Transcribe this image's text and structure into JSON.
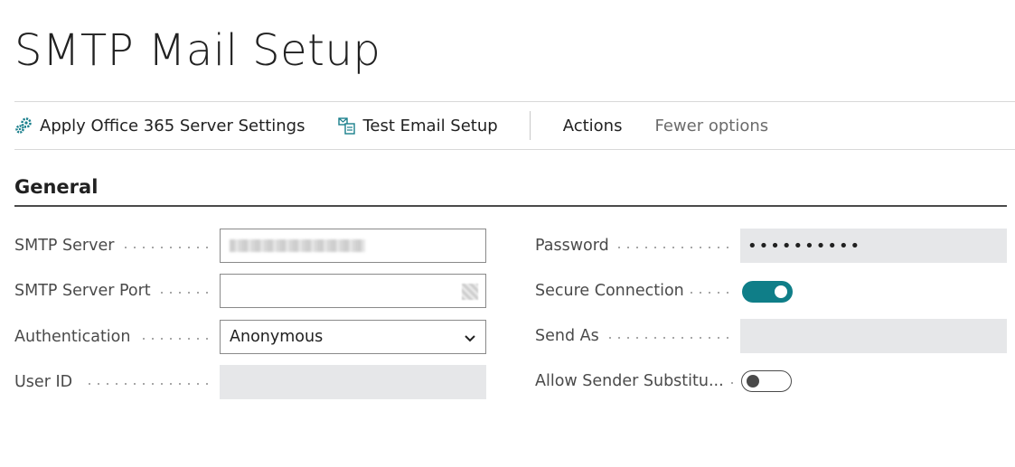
{
  "page": {
    "title": "SMTP Mail Setup"
  },
  "actionbar": {
    "apply_o365": "Apply Office 365 Server Settings",
    "test_email": "Test Email Setup",
    "actions": "Actions",
    "fewer_options": "Fewer options"
  },
  "section": {
    "title": "General"
  },
  "fields": {
    "smtp_server": {
      "label": "SMTP Server",
      "value": ""
    },
    "smtp_server_port": {
      "label": "SMTP Server Port",
      "value": ""
    },
    "authentication": {
      "label": "Authentication",
      "value": "Anonymous"
    },
    "user_id": {
      "label": "User ID",
      "value": ""
    },
    "password": {
      "label": "Password",
      "value": "••••••••••"
    },
    "secure_connection": {
      "label": "Secure Connection",
      "value": true
    },
    "send_as": {
      "label": "Send As",
      "value": ""
    },
    "allow_sender_substitution": {
      "label": "Allow Sender Substitu...",
      "value": false
    }
  },
  "colors": {
    "accent": "#0f7e88",
    "icon_teal": "#1a7f8c"
  },
  "icons": {
    "apply_o365": "gears-icon",
    "test_email": "email-test-icon",
    "dropdown": "chevron-down-icon"
  }
}
